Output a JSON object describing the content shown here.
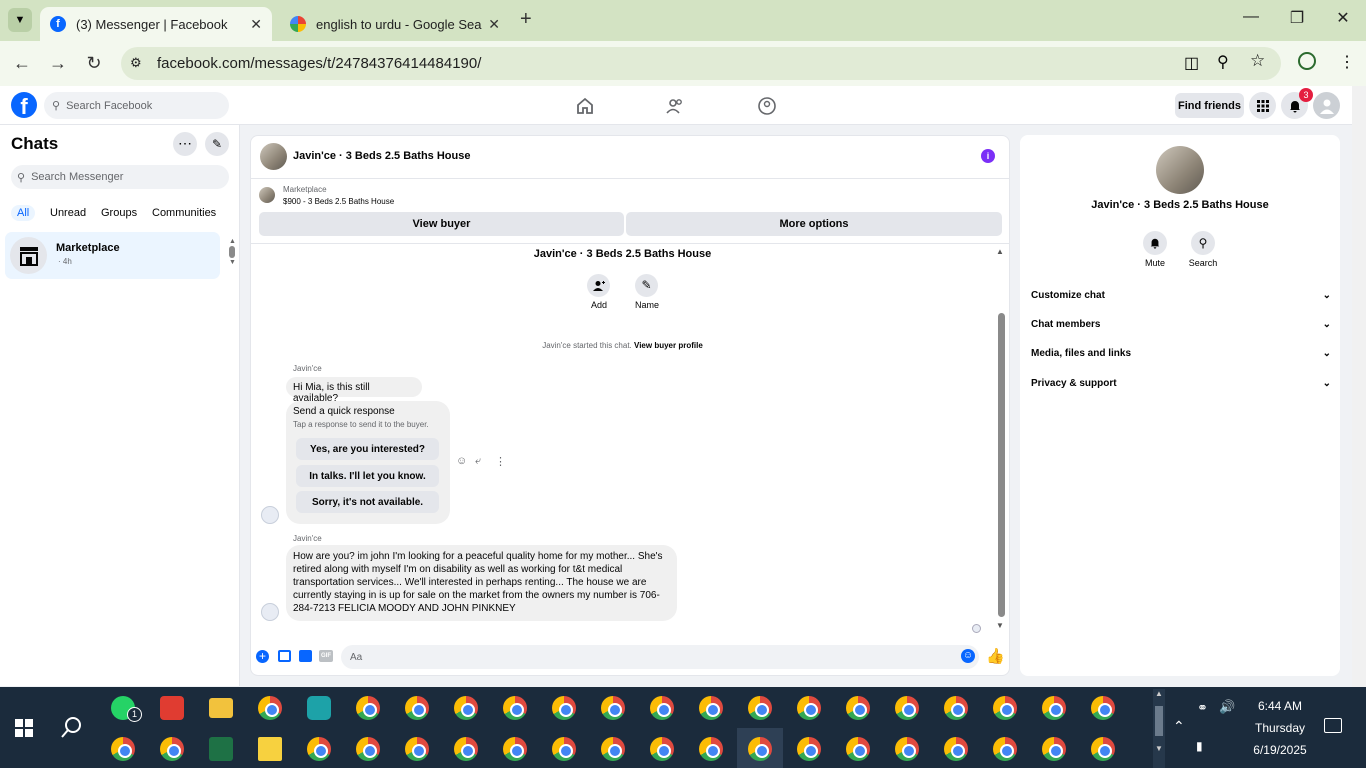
{
  "browser": {
    "tabs": [
      {
        "title": "(3) Messenger | Facebook"
      },
      {
        "title": "english to urdu - Google Search"
      }
    ],
    "url": "facebook.com/messages/t/24784376414484190/"
  },
  "fb_header": {
    "search_placeholder": "Search Facebook",
    "find_friends": "Find friends",
    "notification_count": "3"
  },
  "chats_panel": {
    "title": "Chats",
    "search_placeholder": "Search Messenger",
    "filters": [
      "All",
      "Unread",
      "Groups",
      "Communities"
    ],
    "items": [
      {
        "name": "Marketplace",
        "time": "· 4h"
      }
    ]
  },
  "conversation": {
    "title": "Javin'ce · 3 Beds 2.5 Baths House",
    "listing_source": "Marketplace",
    "listing": "$900 - 3 Beds 2.5 Baths House",
    "view_buyer": "View buyer",
    "more_options": "More options",
    "thread_title": "Javin'ce · 3 Beds 2.5 Baths House",
    "add_label": "Add",
    "name_label": "Name",
    "started_text": "Javin'ce started this chat.",
    "view_buyer_profile": "View buyer profile",
    "sender1": "Javin'ce",
    "message1": "Hi Mia, is this still available?",
    "quick_title": "Send a quick response",
    "quick_sub": "Tap a response to send it to the buyer.",
    "quick_replies": [
      "Yes, are you interested?",
      "In talks. I'll let you know.",
      "Sorry, it's not available."
    ],
    "sender2": "Javin'ce",
    "message2_lines": [
      "How are you?  im john I'm looking for a peaceful quality home for my mother... She's",
      "retired along with myself I'm on disability as well as working for t&t medical",
      "transportation services... We'll interested in perhaps renting... The house we are",
      "currently staying in is up for sale on the market from the owners my number is 706-",
      "284-7213 FELICIA MOODY AND JOHN PINKNEY"
    ],
    "composer_placeholder": "Aa",
    "gif_label": "GIF"
  },
  "info_panel": {
    "name": "Javin'ce · 3 Beds 2.5 Baths House",
    "mute": "Mute",
    "search": "Search",
    "sections": [
      "Customize chat",
      "Chat members",
      "Media, files and links",
      "Privacy & support"
    ]
  },
  "taskbar": {
    "time": "6:44 AM",
    "day": "Thursday",
    "date": "6/19/2025",
    "whatsapp_badge": "1"
  },
  "colors": {
    "fb_blue": "#0866ff",
    "tab_strip": "#d3e3c3",
    "taskbar": "#1b2b3c",
    "info_purple": "#7b2ff7"
  }
}
